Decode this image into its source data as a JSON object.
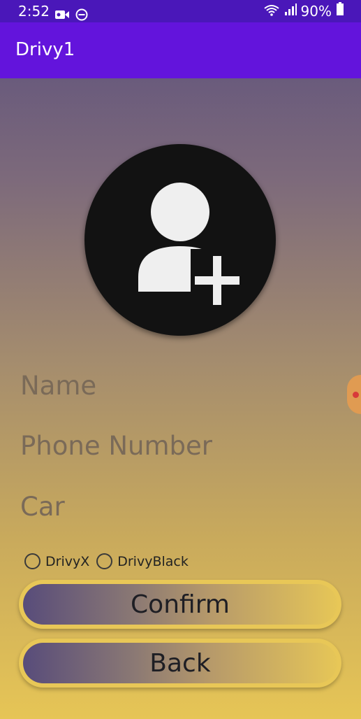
{
  "status_bar": {
    "time": "2:52",
    "battery": "90%",
    "icons": [
      "video-camera-icon",
      "do-not-disturb-icon",
      "wifi-icon",
      "signal-icon",
      "battery-icon"
    ]
  },
  "app_bar": {
    "title": "Drivy1"
  },
  "avatar": {
    "icon": "add-person-icon"
  },
  "form": {
    "name_placeholder": "Name",
    "phone_placeholder": "Phone Number",
    "car_placeholder": "Car"
  },
  "radio_options": [
    {
      "label": "DrivyX",
      "selected": false
    },
    {
      "label": "DrivyBlack",
      "selected": false
    }
  ],
  "buttons": {
    "confirm": "Confirm",
    "back": "Back"
  },
  "colors": {
    "status_bar": "#4a17b9",
    "app_bar": "#6314dc",
    "gradient_top": "#5b4f7c",
    "gradient_bottom": "#e6c556",
    "button_border": "#e8c757"
  }
}
